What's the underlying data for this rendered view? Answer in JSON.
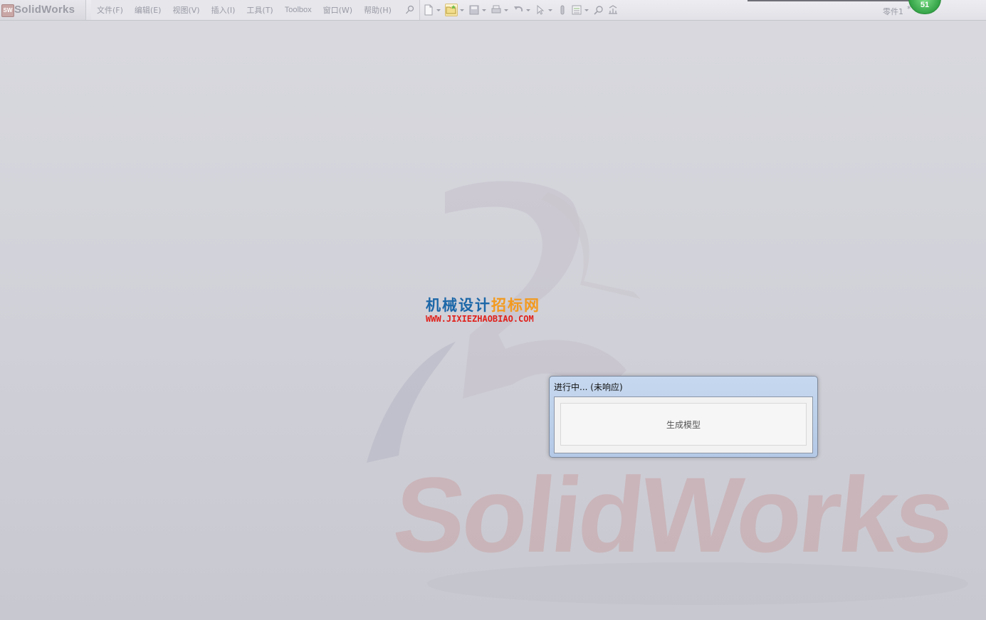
{
  "app": {
    "logo_text": "SolidWorks",
    "logo_badge": "SW"
  },
  "menu": [
    {
      "label": "文件(F)"
    },
    {
      "label": "编辑(E)"
    },
    {
      "label": "视图(V)"
    },
    {
      "label": "插入(I)"
    },
    {
      "label": "工具(T)"
    },
    {
      "label": "Toolbox"
    },
    {
      "label": "窗口(W)"
    },
    {
      "label": "帮助(H)"
    }
  ],
  "document": {
    "title": "零件1",
    "modified_mark": "*"
  },
  "notification_counter": "51",
  "watermark": {
    "cn_part1": "机械设计",
    "cn_part2": "招标网",
    "url": "WWW.JIXIEZHAOBIAO.COM"
  },
  "background_logo_text": "SolidWorks",
  "dialog": {
    "title": "进行中... (未响应)",
    "message": "生成模型"
  },
  "colors": {
    "watermark_blue": "#1c67a8",
    "watermark_orange": "#f39a1f",
    "watermark_red": "#e0201a",
    "counter_green": "#33a246"
  }
}
